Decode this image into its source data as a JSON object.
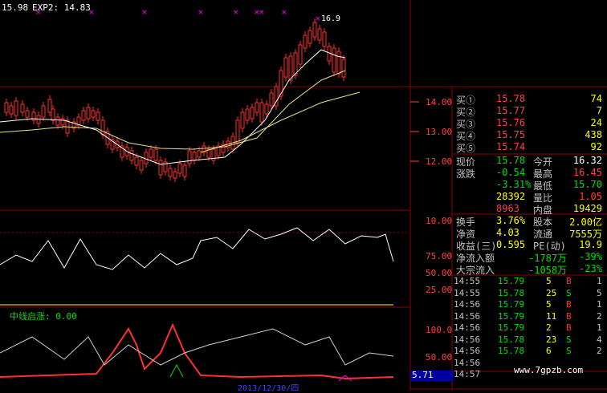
{
  "header": {
    "price_label": "15.98",
    "exp_label": "EXP2: 14.83",
    "peak_label": "16.9"
  },
  "price_axis": [
    "14.00",
    "13.00",
    "12.00"
  ],
  "volume_axis": [
    "10.00"
  ],
  "osc_axis": [
    "75.00",
    "50.00",
    "25.00"
  ],
  "bottom_axis": [
    "100.0",
    "50.00"
  ],
  "bottom_panel_label": "中线启涨: 0.00",
  "bottom_value_box": "5.71",
  "bottom_date_label": "2013/12/30/四",
  "order_book": [
    {
      "label": "买①",
      "price": "15.78",
      "qty": "74"
    },
    {
      "label": "买②",
      "price": "15.77",
      "qty": "7"
    },
    {
      "label": "买③",
      "price": "15.76",
      "qty": "24"
    },
    {
      "label": "买④",
      "price": "15.75",
      "qty": "438"
    },
    {
      "label": "买⑤",
      "price": "15.74",
      "qty": "92"
    }
  ],
  "quote": [
    {
      "label": "现价",
      "value": "15.78",
      "label2": "今开",
      "value2": "16.32"
    },
    {
      "label": "涨跌",
      "value": "-0.54",
      "label2": "最高",
      "value2": "16.45"
    },
    {
      "label": "",
      "value": "-3.31%",
      "label2": "最低",
      "value2": "15.70"
    },
    {
      "label": "",
      "value": "28392",
      "label2": "量比",
      "value2": "1.05"
    },
    {
      "label": "",
      "value": "8963",
      "label2": "内盘",
      "value2": "19429"
    }
  ],
  "fundamentals": [
    {
      "label": "换手",
      "value": "3.76%",
      "label2": "股本",
      "value2": "2.00亿"
    },
    {
      "label": "净资",
      "value": "4.03",
      "label2": "流通",
      "value2": "7555万"
    },
    {
      "label": "收益(三)",
      "value": "0.595",
      "label2": "PE(动)",
      "value2": "19.9"
    }
  ],
  "flows": [
    {
      "label": "净流入额",
      "value": "-1787万",
      "pct": "-39%"
    },
    {
      "label": "大宗流入",
      "value": "-1058万",
      "pct": "-23%"
    }
  ],
  "ticks": [
    {
      "time": "14:55",
      "price": "15.79",
      "vol": "5",
      "side": "B",
      "n": "1"
    },
    {
      "time": "14:55",
      "price": "15.78",
      "vol": "25",
      "side": "S",
      "n": "5"
    },
    {
      "time": "14:56",
      "price": "15.79",
      "vol": "5",
      "side": "B",
      "n": "1"
    },
    {
      "time": "14:56",
      "price": "15.79",
      "vol": "11",
      "side": "B",
      "n": "2"
    },
    {
      "time": "14:56",
      "price": "15.79",
      "vol": "2",
      "side": "B",
      "n": "1"
    },
    {
      "time": "14:56",
      "price": "15.78",
      "vol": "23",
      "side": "S",
      "n": "4"
    },
    {
      "time": "14:56",
      "price": "15.78",
      "vol": "6",
      "side": "S",
      "n": "2"
    },
    {
      "time": "14:56",
      "price": "",
      "vol": "",
      "side": "",
      "n": ""
    },
    {
      "time": "14:57",
      "price": "",
      "vol": "",
      "side": "",
      "n": ""
    }
  ],
  "watermark": "www.7gpzb.com",
  "colors": {
    "up": "#ff3030",
    "down": "#00ffff",
    "grid": "#8b0000",
    "ma_fast": "#ffffff",
    "ma_slow": "#e8e08a",
    "green": "#00e000",
    "yellow": "#ffff00",
    "magenta": "#ff00ff"
  }
}
